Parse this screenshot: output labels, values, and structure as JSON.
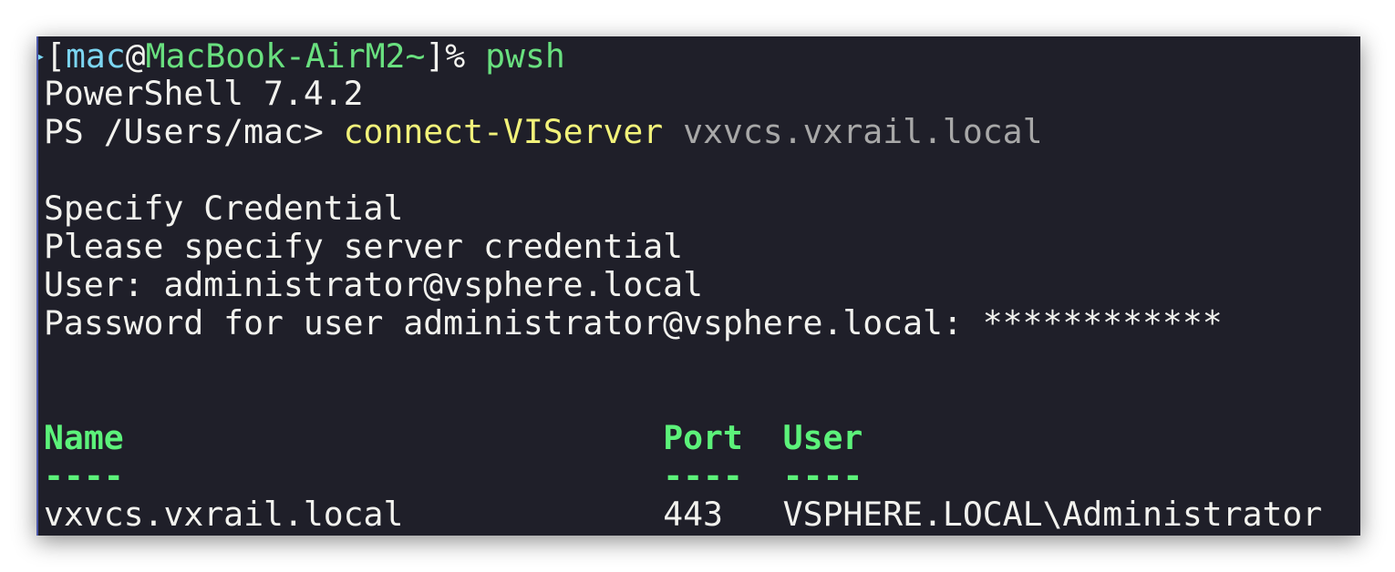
{
  "prompt": {
    "user": "mac",
    "at": "@",
    "host": "MacBook-AirM2",
    "dir": "~",
    "open": "[",
    "close": "]%",
    "command": "pwsh"
  },
  "version": "PowerShell 7.4.2",
  "ps_prompt": "PS /Users/mac> ",
  "cmdlet": "connect-VIServer",
  "argument": "vxvcs.vxrail.local",
  "cred_title": "Specify Credential",
  "cred_msg": "Please specify server credential",
  "user_line": "User: administrator@vsphere.local",
  "password_line": "Password for user administrator@vsphere.local: ************",
  "table": {
    "headers": [
      "Name",
      "Port",
      "User"
    ],
    "separators": [
      "----",
      "----",
      "----"
    ],
    "rows": [
      [
        "vxvcs.vxrail.local",
        "443",
        "VSPHERE.LOCAL\\Administrator"
      ]
    ]
  },
  "colors": {
    "background": "#1f1f29",
    "prompt_user": "#7cd6f2",
    "prompt_host": "#69e07f",
    "cmdlet": "#f2f27a",
    "argument": "#a8a8a8",
    "header": "#5cf27a"
  }
}
